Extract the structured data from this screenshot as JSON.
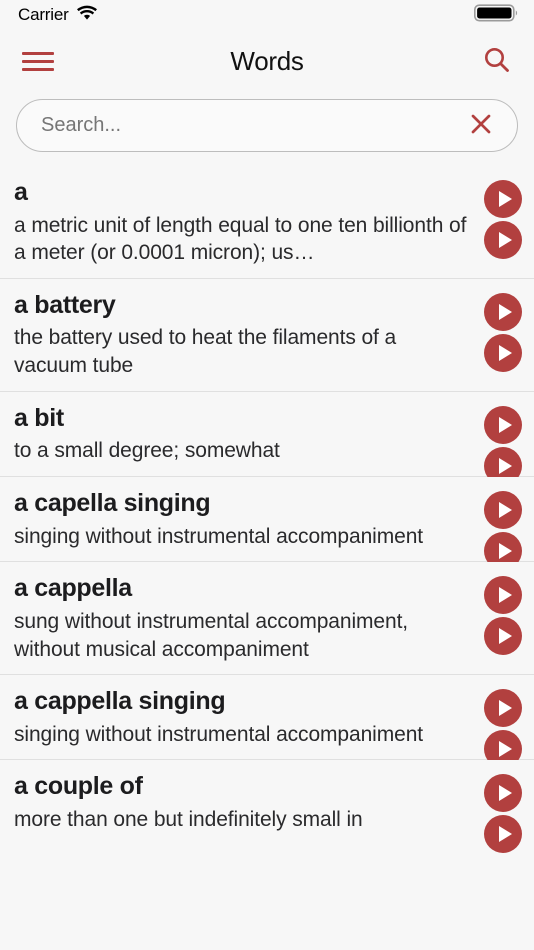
{
  "status_bar": {
    "carrier": "Carrier",
    "wifi_icon": "wifi-icon",
    "battery_icon": "battery-full-icon"
  },
  "nav": {
    "menu_icon": "hamburger-menu-icon",
    "title": "Words",
    "search_icon": "search-icon"
  },
  "search": {
    "value": "",
    "placeholder": "Search...",
    "clear_icon": "close-x-icon"
  },
  "theme": {
    "accent": "#b2403f",
    "background": "#f7f7f7",
    "text": "#1c1c1e",
    "separator": "#e0e0e0"
  },
  "list": {
    "play_icon": "play-circle-icon",
    "items": [
      {
        "term": "a",
        "definition": "a metric unit of length equal to one ten billionth of a meter (or 0.0001 micron); us…"
      },
      {
        "term": "a battery",
        "definition": "the battery used to heat the filaments of a vacuum tube"
      },
      {
        "term": "a bit",
        "definition": "to a small degree; somewhat"
      },
      {
        "term": "a capella singing",
        "definition": "singing without instrumental accompaniment"
      },
      {
        "term": "a cappella",
        "definition": "sung without instrumental accompaniment, without musical accompaniment"
      },
      {
        "term": "a cappella singing",
        "definition": "singing without instrumental accompaniment"
      },
      {
        "term": "a couple of",
        "definition": "more than one but indefinitely small in"
      }
    ]
  }
}
